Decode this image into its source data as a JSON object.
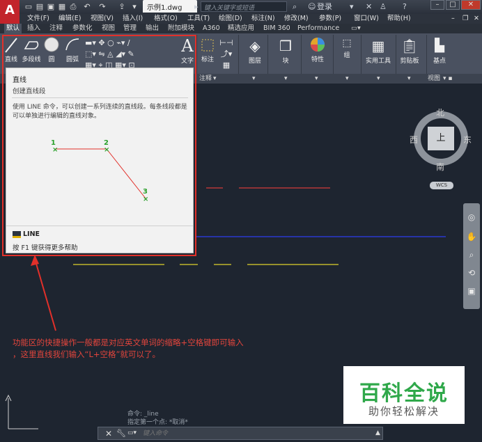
{
  "title_bar": {
    "file_tab": "示例1.dwg",
    "search_placeholder": "键入关键字或短语",
    "login_label": "登录"
  },
  "menu": [
    "文件(F)",
    "编辑(E)",
    "视图(V)",
    "插入(I)",
    "格式(O)",
    "工具(T)",
    "绘图(D)",
    "标注(N)",
    "修改(M)",
    "参数(P)",
    "窗口(W)",
    "帮助(H)"
  ],
  "ribbon_tabs": [
    "默认",
    "插入",
    "注释",
    "参数化",
    "视图",
    "管理",
    "输出",
    "附加模块",
    "A360",
    "精选应用",
    "BIM 360",
    "Performance"
  ],
  "ribbon": {
    "draw_buttons": [
      "直线",
      "多段线",
      "圆",
      "圆弧"
    ],
    "text_label": "文字",
    "dim_label": "标注",
    "annotate_footer": "注释",
    "layer_label": "图层",
    "block_label": "块",
    "props_label": "特性",
    "group_label": "组",
    "utils_label": "实用工具",
    "clipboard_label": "剪贴板",
    "base_label": "基点",
    "view_footer": "视图"
  },
  "tooltip": {
    "title": "直线",
    "subtitle": "创建直线段",
    "description": "使用 LINE 命令，可以创建一系列连续的直线段。每条线段都是可以单独进行编辑的直线对象。",
    "points": [
      "1",
      "2",
      "3"
    ],
    "command": "LINE",
    "help": "按 F1 键获得更多帮助"
  },
  "annotation": {
    "line1": "功能区的快捷操作一般都是对应英文单词的缩略+空格键即可输入",
    "line2": "，这里直线我们输入“L+空格”就可以了。"
  },
  "viewcube": {
    "north": "北",
    "south": "南",
    "east": "东",
    "west": "西",
    "top": "上",
    "wcs": "WCS"
  },
  "command_line": {
    "history_1": "命令: _line",
    "history_2": "指定第一个点: *取消*",
    "placeholder": "键入命令"
  },
  "watermark": {
    "title": "百科全说",
    "subtitle": "助你轻松解决"
  },
  "colors": {
    "accent_red": "#e2302a",
    "autocad_red": "#c2242b",
    "watermark_green": "#2fa84a"
  }
}
